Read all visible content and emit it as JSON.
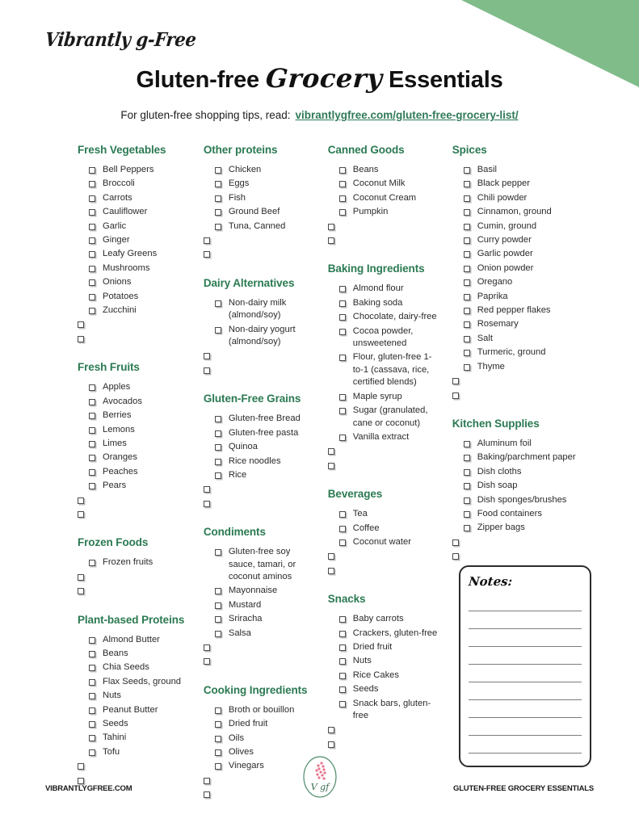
{
  "brand": {
    "mark": "Vibrantly g-Free"
  },
  "header": {
    "title_part1": "Gluten-free",
    "title_script": "Grocery",
    "title_part2": "Essentials",
    "subtitle_prefix": "For gluten-free shopping tips, read:",
    "subtitle_link": "vibrantlygfree.com/gluten-free-grocery-list/"
  },
  "colors": {
    "heading_green": "#2b7a52",
    "link_green": "#2f7a58",
    "corner_green": "#80bc8a",
    "logo_pink": "#e8758f",
    "logo_outline": "#4d8a6a"
  },
  "notes": {
    "title": "Notes:",
    "line_count": 9
  },
  "footer": {
    "left": "VIBRANTLYGFREE.COM",
    "right": "GLUTEN-FREE GROCERY ESSENTIALS",
    "logo_letters": "V gf"
  },
  "columns": [
    {
      "sections": [
        {
          "title": "Fresh Vegetables",
          "items": [
            "Bell Peppers",
            "Broccoli",
            "Carrots",
            "Cauliflower",
            "Garlic",
            "Ginger",
            "Leafy Greens",
            "Mushrooms",
            "Onions",
            "Potatoes",
            "Zucchini"
          ],
          "blanks": 2
        },
        {
          "title": "Fresh Fruits",
          "items": [
            "Apples",
            "Avocados",
            "Berries",
            "Lemons",
            "Limes",
            "Oranges",
            "Peaches",
            "Pears"
          ],
          "blanks": 2
        },
        {
          "title": "Frozen Foods",
          "items": [
            "Frozen fruits"
          ],
          "blanks": 2
        },
        {
          "title": "Plant-based Proteins",
          "items": [
            "Almond Butter",
            "Beans",
            "Chia Seeds",
            "Flax Seeds, ground",
            "Nuts",
            "Peanut Butter",
            "Seeds",
            "Tahini",
            "Tofu"
          ],
          "blanks": 2
        }
      ]
    },
    {
      "sections": [
        {
          "title": "Other proteins",
          "items": [
            "Chicken",
            "Eggs",
            "Fish",
            "Ground Beef",
            "Tuna, Canned"
          ],
          "blanks": 2
        },
        {
          "title": "Dairy Alternatives",
          "items": [
            "Non-dairy milk (almond/soy)",
            "Non-dairy yogurt (almond/soy)"
          ],
          "blanks": 2
        },
        {
          "title": "Gluten-Free Grains",
          "items": [
            "Gluten-free Bread",
            "Gluten-free pasta",
            "Quinoa",
            "Rice noodles",
            "Rice"
          ],
          "blanks": 2
        },
        {
          "title": "Condiments",
          "items": [
            "Gluten-free soy sauce, tamari, or coconut aminos",
            "Mayonnaise",
            "Mustard",
            "Sriracha",
            "Salsa"
          ],
          "blanks": 2
        },
        {
          "title": "Cooking Ingredients",
          "items": [
            "Broth or bouillon",
            "Dried fruit",
            "Oils",
            "Olives",
            "Vinegars"
          ],
          "blanks": 2
        }
      ]
    },
    {
      "sections": [
        {
          "title": "Canned Goods",
          "items": [
            "Beans",
            "Coconut Milk",
            "Coconut Cream",
            "Pumpkin"
          ],
          "blanks": 2
        },
        {
          "title": "Baking Ingredients",
          "items": [
            "Almond flour",
            "Baking soda",
            "Chocolate, dairy-free",
            "Cocoa powder, unsweetened",
            "Flour, gluten-free 1-to-1 (cassava, rice, certified blends)",
            "Maple syrup",
            "Sugar (granulated, cane or coconut)",
            "Vanilla extract"
          ],
          "blanks": 2
        },
        {
          "title": "Beverages",
          "items": [
            "Tea",
            "Coffee",
            "Coconut water"
          ],
          "blanks": 2
        },
        {
          "title": "Snacks",
          "items": [
            "Baby carrots",
            "Crackers, gluten-free",
            "Dried fruit",
            "Nuts",
            "Rice Cakes",
            "Seeds",
            "Snack bars, gluten-free"
          ],
          "blanks": 2
        }
      ]
    },
    {
      "sections": [
        {
          "title": "Spices",
          "items": [
            "Basil",
            "Black pepper",
            "Chili powder",
            "Cinnamon, ground",
            "Cumin, ground",
            "Curry powder",
            "Garlic powder",
            "Onion powder",
            "Oregano",
            "Paprika",
            "Red pepper flakes",
            "Rosemary",
            "Salt",
            "Turmeric, ground",
            "Thyme"
          ],
          "blanks": 2
        },
        {
          "title": "Kitchen Supplies",
          "items": [
            "Aluminum foil",
            "Baking/parchment paper",
            "Dish cloths",
            "Dish soap",
            "Dish sponges/brushes",
            "Food containers",
            "Zipper bags"
          ],
          "blanks": 2
        }
      ]
    }
  ]
}
